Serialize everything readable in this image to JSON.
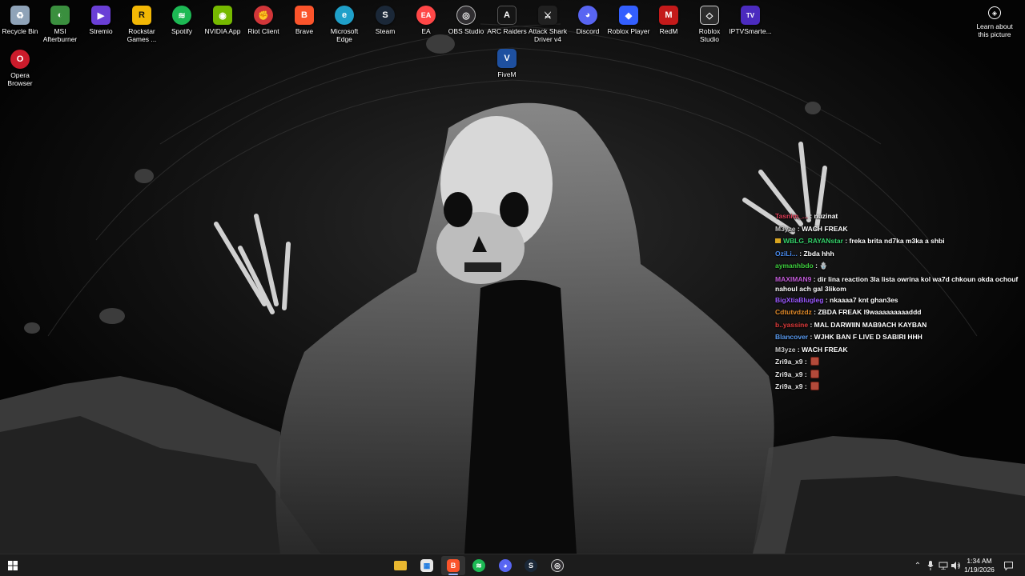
{
  "desktop": {
    "icons": [
      {
        "label": "Recycle Bin",
        "icon": "recycle-bin-icon",
        "color": "#8fa3b8",
        "glyph": "♻"
      },
      {
        "label": "MSI\nAfterburner",
        "icon": "msi-afterburner-icon",
        "color": "#3a8f3e",
        "glyph": "◐"
      },
      {
        "label": "Stremio",
        "icon": "stremio-icon",
        "color": "#6a3fd6",
        "glyph": "▶"
      },
      {
        "label": "Rockstar\nGames ...",
        "icon": "rockstar-games-icon",
        "color": "#f2b705",
        "glyph": "R"
      },
      {
        "label": "Spotify",
        "icon": "spotify-icon",
        "color": "#1db954",
        "glyph": "≋"
      },
      {
        "label": "NVIDIA App",
        "icon": "nvidia-app-icon",
        "color": "#76b900",
        "glyph": "◉"
      },
      {
        "label": "Riot Client",
        "icon": "riot-client-icon",
        "color": "#d13639",
        "glyph": "✊"
      },
      {
        "label": "Brave",
        "icon": "brave-icon",
        "color": "#fb542b",
        "glyph": "B"
      },
      {
        "label": "Microsoft\nEdge",
        "icon": "edge-icon",
        "color": "#1fa0c9",
        "glyph": "e"
      },
      {
        "label": "Steam",
        "icon": "steam-icon",
        "color": "#1b2838",
        "glyph": "S"
      },
      {
        "label": "EA",
        "icon": "ea-icon",
        "color": "#ff4747",
        "glyph": "EA"
      },
      {
        "label": "OBS Studio",
        "icon": "obs-studio-icon",
        "color": "#302e31",
        "glyph": "◎"
      },
      {
        "label": "ARC Raiders",
        "icon": "arc-raiders-icon",
        "color": "#151515",
        "glyph": "A"
      },
      {
        "label": "Attack Shark\nDriver v4",
        "icon": "attack-shark-icon",
        "color": "#202020",
        "glyph": "⚔"
      },
      {
        "label": "Discord",
        "icon": "discord-icon",
        "color": "#5865f2",
        "glyph": "◕"
      },
      {
        "label": "Roblox Player",
        "icon": "roblox-player-icon",
        "color": "#335fff",
        "glyph": "◆"
      },
      {
        "label": "RedM",
        "icon": "redm-icon",
        "color": "#c41a1a",
        "glyph": "M"
      },
      {
        "label": "Roblox\nStudio",
        "icon": "roblox-studio-icon",
        "color": "#2b2b2b",
        "glyph": "◇"
      },
      {
        "label": "IPTVSmarte...",
        "icon": "iptv-smarters-icon",
        "color": "#4b2bbf",
        "glyph": "TV"
      },
      {
        "label": "Opera\nBrowser",
        "icon": "opera-browser-icon",
        "color": "#cc1b2b",
        "glyph": "O"
      },
      {
        "label": "FiveM",
        "icon": "fivem-icon",
        "color": "#1e50a0",
        "glyph": "V"
      }
    ],
    "learn": {
      "label": "Learn about\nthis picture",
      "icon": "camera-lens-icon"
    }
  },
  "chat": {
    "messages": [
      {
        "user": "Tasnim_...",
        "user_color": "#e0405a",
        "text": "nuzinat"
      },
      {
        "user": "M3yze",
        "user_color": "#c8c8c8",
        "text": "WACH FREAK"
      },
      {
        "user": "WBLG_RAYANstar",
        "user_color": "#35d06a",
        "text": "freka brita nd7ka m3ka a shbi",
        "badge": true
      },
      {
        "user": "OziLi...",
        "user_color": "#4a8cf0",
        "text": "Zbda hhh"
      },
      {
        "user": "aymanhbdo",
        "user_color": "#3fd03f",
        "text": "🪬"
      },
      {
        "user": "MAXIMAN9",
        "user_color": "#c25cd8",
        "text": "dir lina reaction 3la lista owrina kol wa7d chkoun okda ochouf nahoul ach gal 3likom"
      },
      {
        "user": "BigXtiaBlugleg",
        "user_color": "#9b59ff",
        "text": "nkaaaa7 knt ghan3es"
      },
      {
        "user": "Cdtutvdzdz",
        "user_color": "#e08a2a",
        "text": "ZBDA FREAK l9waaaaaaaaaddd"
      },
      {
        "user": "b..yassine",
        "user_color": "#e03c3c",
        "text": "MAL DARWIIN MAB9ACH KAYBAN"
      },
      {
        "user": "Blancover",
        "user_color": "#5a9bf0",
        "text": "WJHK BAN F LIVE D SABIRI HHH"
      },
      {
        "user": "M3yze",
        "user_color": "#c8c8c8",
        "text": "WACH FREAK"
      },
      {
        "user": "Zri9a_x9",
        "user_color": "#e8e8e8",
        "text": "",
        "emote": true
      },
      {
        "user": "Zri9a_x9",
        "user_color": "#e8e8e8",
        "text": "",
        "emote": true
      },
      {
        "user": "Zri9a_x9",
        "user_color": "#e8e8e8",
        "text": "",
        "emote": true
      }
    ]
  },
  "taskbar": {
    "start_icon": "windows-start-icon",
    "apps": [
      {
        "name": "file-explorer",
        "icon": "folder-icon",
        "color": "#e8b730",
        "glyph": "▬"
      },
      {
        "name": "microsoft-store",
        "icon": "store-icon",
        "color": "#e8e8e8",
        "glyph": "▦"
      },
      {
        "name": "brave",
        "icon": "brave-icon",
        "color": "#fb542b",
        "glyph": "B",
        "active": true
      },
      {
        "name": "spotify",
        "icon": "spotify-icon",
        "color": "#1db954",
        "glyph": "≋"
      },
      {
        "name": "discord",
        "icon": "discord-icon",
        "color": "#5865f2",
        "glyph": "◕"
      },
      {
        "name": "steam",
        "icon": "steam-icon",
        "color": "#1b2838",
        "glyph": "S"
      },
      {
        "name": "obs-studio",
        "icon": "obs-studio-icon",
        "color": "#302e31",
        "glyph": "◎"
      }
    ],
    "tray": [
      {
        "icon": "chevron-up-icon",
        "glyph": "⌃"
      },
      {
        "icon": "microphone-icon",
        "glyph": "🎙"
      },
      {
        "icon": "network-icon",
        "glyph": "🖧"
      },
      {
        "icon": "speaker-icon",
        "glyph": "🔊"
      }
    ],
    "time": "1:34 AM",
    "date": "1/19/2026",
    "notifications_icon": "notifications-icon"
  }
}
